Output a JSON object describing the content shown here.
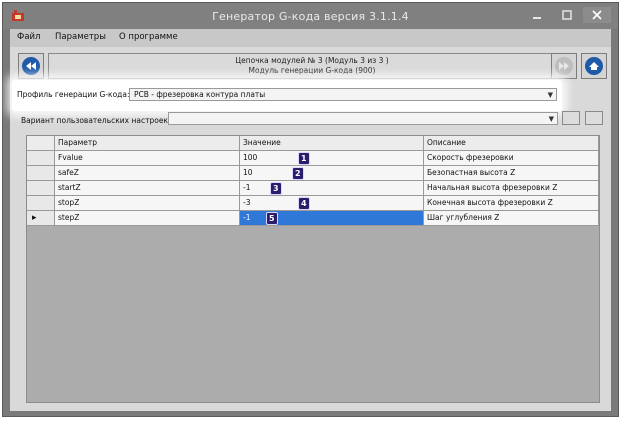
{
  "window": {
    "title": "Генератор G-кода версия 3.1.1.4"
  },
  "menu": {
    "items": [
      "Файл",
      "Параметры",
      "О программе"
    ]
  },
  "chain": {
    "line1": "Цепочка модулей № 3 (Модуль 3 из 3 )",
    "line2": "Модуль генерации G-кода (900)"
  },
  "profile": {
    "label": "Профиль генерации G-кода:",
    "value": "PCB - фрезеровка контура платы"
  },
  "variant": {
    "label": "Вариант пользовательских настроек:",
    "value": ""
  },
  "table": {
    "columns": [
      "Параметр",
      "Значение",
      "Описание"
    ],
    "rows": [
      {
        "param": "Fvalue",
        "value": "100",
        "desc": "Скорость фрезеровки",
        "badge": "1"
      },
      {
        "param": "safeZ",
        "value": "10",
        "desc": "Безопастная высота Z",
        "badge": "2"
      },
      {
        "param": "startZ",
        "value": "-1",
        "desc": "Начальная высота фрезеровки Z",
        "badge": "3"
      },
      {
        "param": "stopZ",
        "value": "-3",
        "desc": "Конечная высота фрезеровки Z",
        "badge": "4"
      },
      {
        "param": "stepZ",
        "value": "-1",
        "desc": "Шаг углубления Z",
        "badge": "5",
        "selected": true
      }
    ]
  },
  "colors": {
    "selection": "#2f78d8",
    "badge": "#2b1d6b",
    "nav_accent": "#1e5aa8"
  }
}
